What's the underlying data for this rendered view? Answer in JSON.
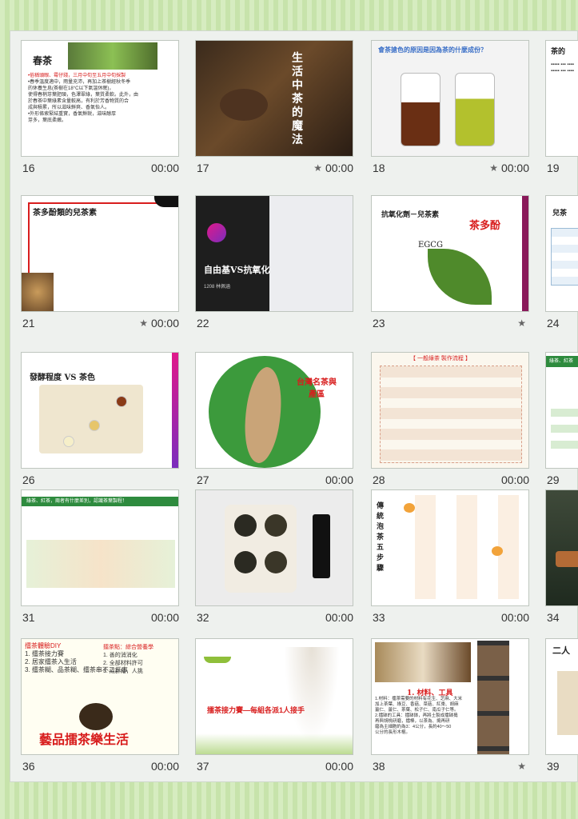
{
  "grid": {
    "slides": [
      {
        "num": "16",
        "dur": "00:00",
        "star": false,
        "title": "春茶",
        "body": [
          "•俗稱頭眼、霉仔錢，三月中旬至五月中旬採製",
          "•春季溫度適中，雨量充沛，再加上茶樹經秋冬季",
          "的休養生息(茶樹在18°C以下氣溫休眠)，",
          "使得春梢芽葉肥碩，色澤翠綠，葉質柔軟。此外，由",
          "於春茶中葉綠素含量較高，有利於芳香物質的合",
          "成與積累，所以滋味鮮爽、香氣怡人。",
          "•外形條索緊結重實，香氣鮮鋭，滋味醇厚",
          "芽多，葉底柔嫩。"
        ]
      },
      {
        "num": "17",
        "dur": "00:00",
        "star": true,
        "title": "生活中茶的魔法"
      },
      {
        "num": "18",
        "dur": "00:00",
        "star": true,
        "title": "會茶搶色的原因是因為茶的什麼成份？"
      },
      {
        "num": "19",
        "dur": "",
        "star": false,
        "title": "茶的"
      },
      {
        "num": "21",
        "dur": "00:00",
        "star": true,
        "title": "茶多酚類的兒茶素"
      },
      {
        "num": "22",
        "dur": "",
        "star": false,
        "title": "自由基VS抗氧化",
        "sub": "1208 林佩涵"
      },
      {
        "num": "23",
        "dur": "",
        "star": true,
        "title": "抗氧化劑－兒茶素",
        "tag": "茶多酚",
        "chem": "EGCG"
      },
      {
        "num": "24",
        "dur": "",
        "star": false,
        "title": "兒茶"
      },
      {
        "num": "26",
        "dur": "",
        "star": false,
        "title": "發酵程度 VS 茶色"
      },
      {
        "num": "27",
        "dur": "00:00",
        "star": false,
        "title": "台灣名茶與產區"
      },
      {
        "num": "28",
        "dur": "00:00",
        "star": false,
        "title": "【 一般綠茶 製作流程 】"
      },
      {
        "num": "29",
        "dur": "",
        "star": false,
        "title": "綠茶、紅茶"
      },
      {
        "num": "31",
        "dur": "00:00",
        "star": false,
        "title": "綠茶、紅茶，兩者有什麼差別，認識茶葉製程！"
      },
      {
        "num": "32",
        "dur": "00:00",
        "star": false,
        "title": ""
      },
      {
        "num": "33",
        "dur": "00:00",
        "star": false,
        "title": "傳統泡茶五步驟"
      },
      {
        "num": "34",
        "dur": "",
        "star": false,
        "title": ""
      },
      {
        "num": "36",
        "dur": "00:00",
        "star": false,
        "title": "擂茶體驗DIY",
        "items": [
          "1. 擂茶接力賽",
          "2. 居家擂茶入生活",
          "3. 擂茶糊、品茶糊、擂茶串不二三事"
        ],
        "right": "擂茶點：綜合營養學",
        "ritems": [
          "1. 善的消消化",
          "2. 全部材料許可",
          "3. 成群結，人挑"
        ],
        "footer": "藝品擂茶樂生活"
      },
      {
        "num": "37",
        "dur": "00:00",
        "star": false,
        "title": "擂茶接力賽—每組各派1人接手"
      },
      {
        "num": "38",
        "dur": "",
        "star": true,
        "title": "1. 材料、工具",
        "body": [
          "1.材料：擂茶需要的材料有花生、芝麻、大米",
          "加上茶葉、綠豆、香菇、菜菇、紅棗、胡麻",
          "薑仁、薑仁、茶葉、松子仁、南瓜子仁等。",
          "2.擂缽的工具：擂缽鉢，再將土製成擂缽搗",
          "再與胡桃研磨，擂棒，以茶為、搗再研",
          "磨為主細胞約為3：4公分，長約40～50",
          "公分的長形木棍。"
        ]
      },
      {
        "num": "39",
        "dur": "",
        "star": false,
        "title": "二人"
      }
    ]
  },
  "colors": {
    "accent": "#d81d1d",
    "green": "#2e8b3e",
    "magenta": "#e0198a"
  }
}
